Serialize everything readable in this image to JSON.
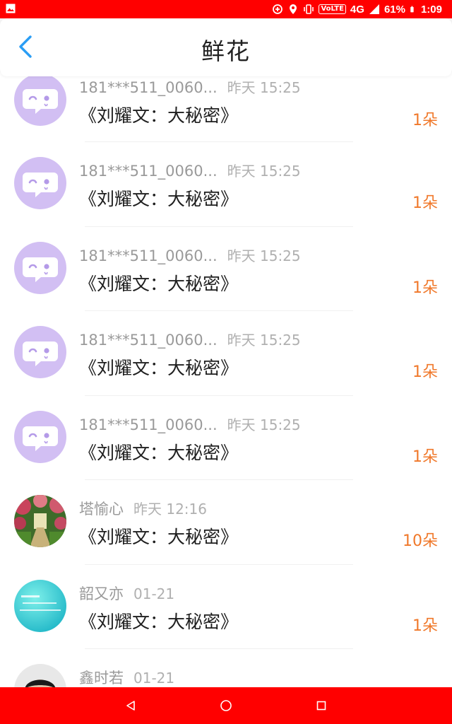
{
  "status_bar": {
    "volte": "VoLTE",
    "network": "4G",
    "battery": "61%",
    "time": "1:09"
  },
  "header": {
    "title": "鲜花"
  },
  "list": [
    {
      "name": "181***511_0060...",
      "time": "昨天 15:25",
      "title": "《刘耀文：大秘密》",
      "count": "1朵",
      "avatar": "default-chat-avatar"
    },
    {
      "name": "181***511_0060...",
      "time": "昨天 15:25",
      "title": "《刘耀文：大秘密》",
      "count": "1朵",
      "avatar": "default-chat-avatar"
    },
    {
      "name": "181***511_0060...",
      "time": "昨天 15:25",
      "title": "《刘耀文：大秘密》",
      "count": "1朵",
      "avatar": "default-chat-avatar"
    },
    {
      "name": "181***511_0060...",
      "time": "昨天 15:25",
      "title": "《刘耀文：大秘密》",
      "count": "1朵",
      "avatar": "default-chat-avatar"
    },
    {
      "name": "181***511_0060...",
      "time": "昨天 15:25",
      "title": "《刘耀文：大秘密》",
      "count": "1朵",
      "avatar": "default-chat-avatar"
    },
    {
      "name": "塔愉心",
      "time": "昨天 12:16",
      "title": "《刘耀文：大秘密》",
      "count": "10朵",
      "avatar": "garden-photo-avatar"
    },
    {
      "name": "韶又亦",
      "time": "01-21",
      "title": "《刘耀文：大秘密》",
      "count": "1朵",
      "avatar": "cyan-text-avatar"
    },
    {
      "name": "鑫时若",
      "time": "01-21",
      "title": "",
      "count": "",
      "avatar": "person-photo-avatar"
    }
  ],
  "colors": {
    "accent": "#2a9df4",
    "count": "#f0782a",
    "status_bar": "#ff0000",
    "default_avatar": "#d2bff3"
  }
}
